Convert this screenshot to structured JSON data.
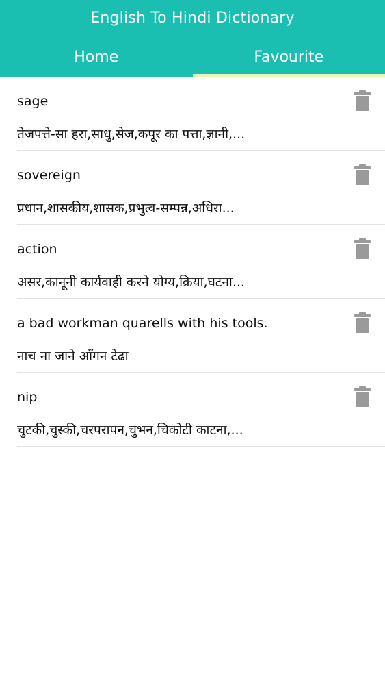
{
  "header": {
    "title": "English To Hindi Dictionary",
    "tabs": [
      {
        "label": "Home",
        "active": false
      },
      {
        "label": "Favourite",
        "active": true
      }
    ],
    "bg_color": "#1abfb1",
    "indicator_color": "#e6f7b0"
  },
  "favourites": [
    {
      "word": "sage",
      "meaning": "तेजपत्ते-सा हरा,साधु,सेज,कपूर का पत्ता,ज्ञानी,..."
    },
    {
      "word": "sovereign",
      "meaning": "प्रधान,शासकीय,शासक,प्रभुत्व-सम्पन्न,अधिरा..."
    },
    {
      "word": "action",
      "meaning": "असर,कानूनी कार्यवाही करने योग्य,क्रिया,घटना..."
    },
    {
      "word": "a bad workman quarells with his tools.",
      "meaning": "नाच ना जाने आँगन टेढा"
    },
    {
      "word": "nip",
      "meaning": "चुटकी,चुस्की,चरपरापन,चुभन,चिकोटी काटना,..."
    }
  ],
  "icons": {
    "delete": "trash-icon"
  }
}
